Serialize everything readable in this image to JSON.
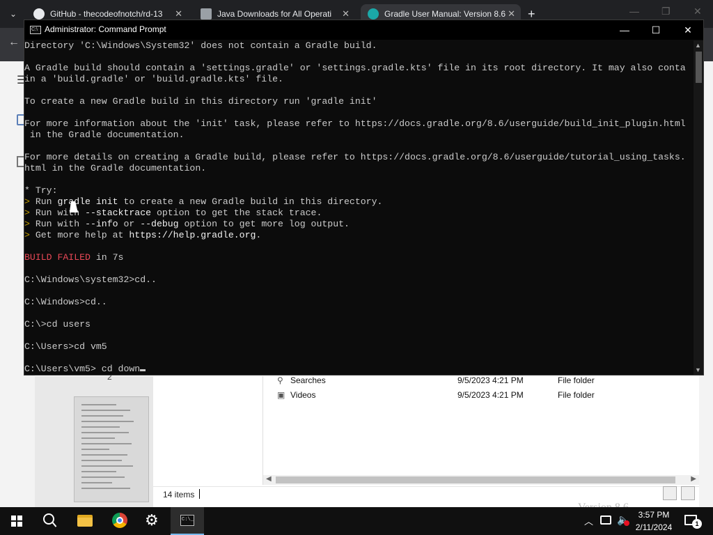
{
  "browser": {
    "tabs": [
      {
        "title": "GitHub - thecodeofnotch/rd-13"
      },
      {
        "title": "Java Downloads for All Operati"
      },
      {
        "title": "Gradle User Manual: Version 8.6"
      }
    ],
    "new_tab": "+",
    "close": "✕"
  },
  "cmd": {
    "title": "Administrator: Command Prompt",
    "lines": [
      [
        {
          "t": "Directory 'C:\\Windows\\System32' does not contain a Gradle build."
        }
      ],
      [
        {
          "t": ""
        }
      ],
      [
        {
          "t": "A Gradle build should contain a 'settings.gradle' or 'settings.gradle.kts' file in its root directory. It may also conta"
        }
      ],
      [
        {
          "t": "in a 'build.gradle' or 'build.gradle.kts' file."
        }
      ],
      [
        {
          "t": ""
        }
      ],
      [
        {
          "t": "To create a new Gradle build in this directory run 'gradle init'"
        }
      ],
      [
        {
          "t": ""
        }
      ],
      [
        {
          "t": "For more information about the 'init' task, please refer to https://docs.gradle.org/8.6/userguide/build_init_plugin.html"
        }
      ],
      [
        {
          "t": " in the Gradle documentation."
        }
      ],
      [
        {
          "t": ""
        }
      ],
      [
        {
          "t": "For more details on creating a Gradle build, please refer to https://docs.gradle.org/8.6/userguide/tutorial_using_tasks."
        }
      ],
      [
        {
          "t": "html in the Gradle documentation."
        }
      ],
      [
        {
          "t": ""
        }
      ],
      [
        {
          "t": "* Try:"
        }
      ],
      [
        {
          "t": "> ",
          "c": "y"
        },
        {
          "t": "Run "
        },
        {
          "t": "gradle init",
          "c": "b"
        },
        {
          "t": " to create a new Gradle build in this directory."
        }
      ],
      [
        {
          "t": "> ",
          "c": "y"
        },
        {
          "t": "Run with "
        },
        {
          "t": "--stacktrace",
          "c": "b"
        },
        {
          "t": " option to get the stack trace."
        }
      ],
      [
        {
          "t": "> ",
          "c": "y"
        },
        {
          "t": "Run with "
        },
        {
          "t": "--info",
          "c": "b"
        },
        {
          "t": " or "
        },
        {
          "t": "--debug",
          "c": "b"
        },
        {
          "t": " option to get more log output."
        }
      ],
      [
        {
          "t": "> ",
          "c": "y"
        },
        {
          "t": "Get more help at "
        },
        {
          "t": "https://help.gradle.org",
          "c": "b"
        },
        {
          "t": "."
        }
      ],
      [
        {
          "t": ""
        }
      ],
      [
        {
          "t": "BUILD FAILED",
          "c": "r"
        },
        {
          "t": " in 7s"
        }
      ],
      [
        {
          "t": ""
        }
      ],
      [
        {
          "t": "C:\\Windows\\system32>cd.."
        }
      ],
      [
        {
          "t": ""
        }
      ],
      [
        {
          "t": "C:\\Windows>cd.."
        }
      ],
      [
        {
          "t": ""
        }
      ],
      [
        {
          "t": "C:\\>cd users"
        }
      ],
      [
        {
          "t": ""
        }
      ],
      [
        {
          "t": "C:\\Users>cd vm5"
        }
      ],
      [
        {
          "t": ""
        }
      ],
      [
        {
          "t": "C:\\Users\\vm5> cd down"
        },
        {
          "t": "",
          "cursor": true
        }
      ]
    ]
  },
  "explorer": {
    "preview_number": "2",
    "files": [
      {
        "icon": "⚲",
        "name": "Searches",
        "date": "9/5/2023 4:21 PM",
        "type": "File folder"
      },
      {
        "icon": "▣",
        "name": "Videos",
        "date": "9/5/2023 4:21 PM",
        "type": "File folder"
      }
    ],
    "status_items": "14 items",
    "faded_heading": "Version 8.6"
  },
  "taskbar": {
    "time": "3:57 PM",
    "date": "2/11/2024",
    "notification_count": "1"
  }
}
